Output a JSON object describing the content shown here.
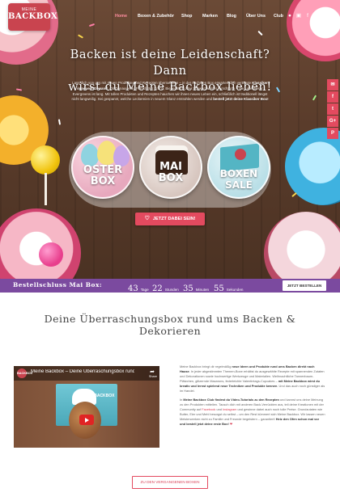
{
  "brand": {
    "small": "MEINE",
    "big": "BACKBOX"
  },
  "nav": [
    {
      "label": "Home",
      "active": true
    },
    {
      "label": "Boxen & Zubehör",
      "active": false
    },
    {
      "label": "Shop",
      "active": false
    },
    {
      "label": "Marken",
      "active": false
    },
    {
      "label": "Blog",
      "active": false
    },
    {
      "label": "Über Uns",
      "active": false
    },
    {
      "label": "Club",
      "active": false
    }
  ],
  "social_icons": [
    "user-icon",
    "cart-icon",
    "facebook-icon",
    "instagram-icon",
    "youtube-icon",
    "search-icon"
  ],
  "hero": {
    "title_line1": "Backen ist deine Leidenschaft? Dann",
    "title_line2": "wirst du Meine Backbox lieben!",
    "text": {
      "p1": "Lass dich von uns mit neuen Produkten und Rezepten überraschen – in der nächsten Box erwarten dich vertraute",
      "b1": "Klassiker in neuem Gewand",
      "p2": ". Ob Donauwelle, Frankfurter Kranz, Bienenstich oder Schwarzwälder Kirschtorte – die Liste dieser Evergreens ist lang. Mit tollen Produkten und Rezepten hauchen wir ihnen neues Leben ein, schließlich ist traditionell längst nicht langweilig. Sei gespannt, welche Leckereien in neuem Glanz erstrahlen werden und",
      "b2": "bestell jetzt deine Klassiker Box!"
    },
    "boxes": [
      {
        "line1": "OSTER",
        "line2": "BOX"
      },
      {
        "line1": "MAI",
        "line2": "BOX"
      },
      {
        "line1": "BOXEN",
        "line2": "SALE"
      }
    ],
    "cta_label": "JETZT DABEI SEIN!"
  },
  "side_share": [
    "✉",
    "f",
    "t",
    "G+",
    "P"
  ],
  "countdown": {
    "label": "Bestellschluss Mai Box:",
    "units": [
      {
        "value": "43",
        "label": "Tage"
      },
      {
        "value": "22",
        "label": "Stunden"
      },
      {
        "value": "35",
        "label": "Minuten"
      },
      {
        "value": "55",
        "label": "Sekunden"
      }
    ],
    "button": "JETZT BESTELLEN"
  },
  "section_title": "Deine Überraschungsbox rund ums Backen & Dekorieren",
  "video": {
    "logo": "BACKBOX",
    "title": "Meine Backbox – Deine Überraschungsbox rund ...",
    "share": "Share",
    "box_text": "MEINE BACKBOX"
  },
  "description": {
    "p1_a": "Meine Backbox bringt dir regelmäßig",
    "p1_b": "neue Ideen und Produkte rund ums Backen direkt nach Hause",
    "p1_c": ". In jeder abgestimmten Themen-Boxe erhältst du ausgewählte Rezepte mit spannenden Zutaten und Dekorationen sowie hochwertige Werkzeuge und Materialien. Weihnachtliche Tannenbaum-Plätzchen, glitzernde Macarons, federleichte Valentintags-Cupcakes –",
    "p1_d": "mit Meine Backbox wirst du kreativ und lernst spielend neue Techniken und Produkte kennen",
    "p1_e": ". Und das auch noch günstiger als im Handel.",
    "p2_a": "In",
    "p2_club": "Meine Backbox Club",
    "p2_b": "findest du Video-Tutorials zu den Rezepten",
    "p2_c": "und kannst uns deine Meinung zu den Produkten mitteilen. Tausch dich mit anderen Back-Verrückten aus, teil deine Kreationen mit der Community auf",
    "p2_fb": "Facebook",
    "p2_and": "und",
    "p2_ig": "Instagram",
    "p2_d": "und gewinne dabei auch noch tolle Preise. Grundzutaten wie Butter, Eier und Mehl besorgst du selbst – um den Rest kümmert sich Meine Backbox. Wir lassen neuen Meisterwerken nicht zu Familie und Freunde begeistern – garantiert!",
    "p2_e": "Heiz den Ofen schon mal vor und bestell jetzt deine erste Box!",
    "p2_heart": " ❤"
  },
  "past_boxes_button": "ZU DEN VERGANGENEN BOXEN",
  "colors": {
    "accent": "#e34a5f",
    "countdown_bg": "#7b4a9f",
    "wood": "#5a3c2b"
  }
}
